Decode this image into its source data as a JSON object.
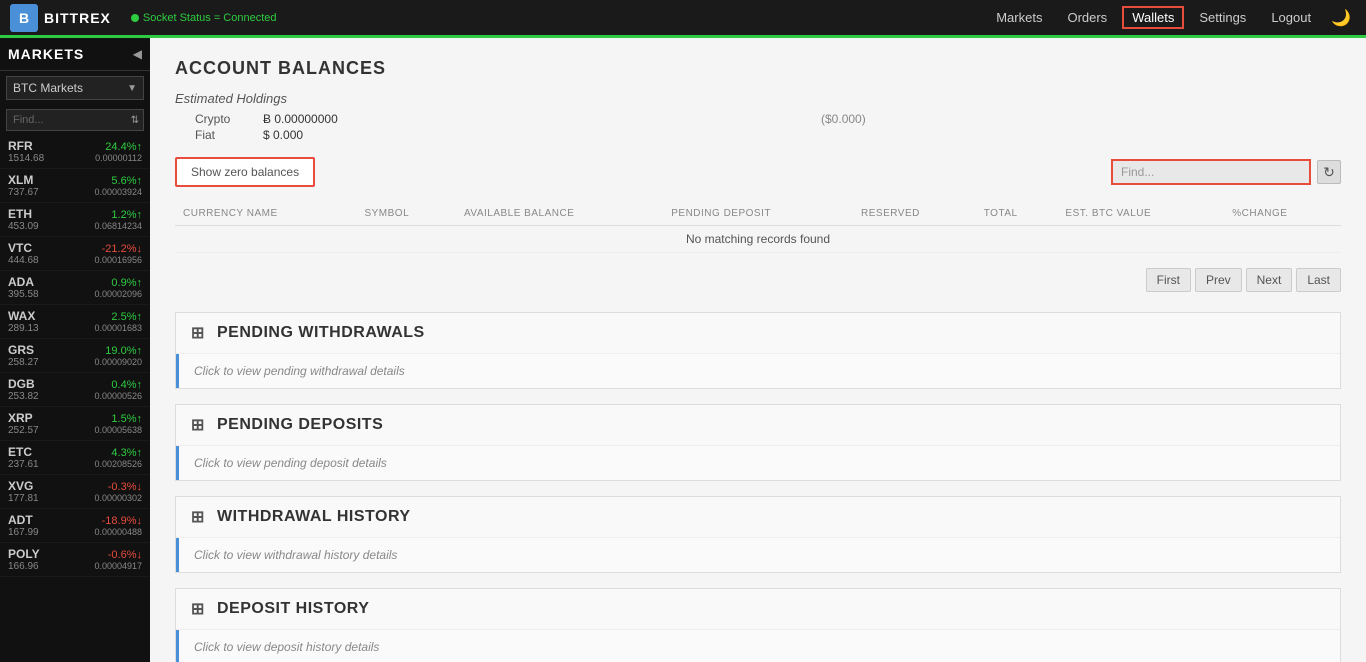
{
  "topnav": {
    "logo_text": "BITTREX",
    "socket_status": "Socket Status = Connected",
    "links": [
      "Markets",
      "Orders",
      "Wallets",
      "Settings",
      "Logout"
    ]
  },
  "sidebar": {
    "title": "MARKETS",
    "collapse_icon": "◀",
    "market_select_label": "BTC Markets",
    "search_placeholder": "Find...",
    "coins": [
      {
        "name": "RFR",
        "price": "1514.68",
        "change": "24.4%↑",
        "btc": "0.00000112",
        "positive": true
      },
      {
        "name": "XLM",
        "price": "737.67",
        "change": "5.6%↑",
        "btc": "0.00003924",
        "positive": true
      },
      {
        "name": "ETH",
        "price": "453.09",
        "change": "1.2%↑",
        "btc": "0.06814234",
        "positive": true
      },
      {
        "name": "VTC",
        "price": "444.68",
        "change": "-21.2%↓",
        "btc": "0.00016956",
        "positive": false
      },
      {
        "name": "ADA",
        "price": "395.58",
        "change": "0.9%↑",
        "btc": "0.00002096",
        "positive": true
      },
      {
        "name": "WAX",
        "price": "289.13",
        "change": "2.5%↑",
        "btc": "0.00001683",
        "positive": true
      },
      {
        "name": "GRS",
        "price": "258.27",
        "change": "19.0%↑",
        "btc": "0.00009020",
        "positive": true
      },
      {
        "name": "DGB",
        "price": "253.82",
        "change": "0.4%↑",
        "btc": "0.00000526",
        "positive": true
      },
      {
        "name": "XRP",
        "price": "252.57",
        "change": "1.5%↑",
        "btc": "0.00005638",
        "positive": true
      },
      {
        "name": "ETC",
        "price": "237.61",
        "change": "4.3%↑",
        "btc": "0.00208526",
        "positive": true
      },
      {
        "name": "XVG",
        "price": "177.81",
        "change": "-0.3%↓",
        "btc": "0.00000302",
        "positive": false
      },
      {
        "name": "ADT",
        "price": "167.99",
        "change": "-18.9%↓",
        "btc": "0.00000488",
        "positive": false
      },
      {
        "name": "POLY",
        "price": "166.96",
        "change": "-0.6%↓",
        "btc": "0.00004917",
        "positive": false
      }
    ]
  },
  "content": {
    "account_balances_title": "ACCOUNT BALANCES",
    "estimated_holdings_label": "Estimated Holdings",
    "holdings": {
      "crypto_label": "Crypto",
      "crypto_value": "Ƀ 0.00000000",
      "crypto_paren": "($0.000)",
      "fiat_label": "Fiat",
      "fiat_value": "$ 0.000"
    },
    "show_zero_btn": "Show zero balances",
    "find_placeholder": "Find...",
    "table": {
      "headers": [
        "CURRENCY NAME",
        "SYMBOL",
        "AVAILABLE BALANCE",
        "PENDING DEPOSIT",
        "RESERVED",
        "TOTAL",
        "EST. BTC VALUE",
        "%CHANGE"
      ],
      "no_records": "No matching records found"
    },
    "pagination": {
      "first": "First",
      "prev": "Prev",
      "next": "Next",
      "last": "Last"
    },
    "pending_withdrawals": {
      "title": "PENDING WITHDRAWALS",
      "body": "Click to view pending withdrawal details"
    },
    "pending_deposits": {
      "title": "PENDING DEPOSITS",
      "body": "Click to view pending deposit details"
    },
    "withdrawal_history": {
      "title": "WITHDRAWAL HISTORY",
      "body": "Click to view withdrawal history details"
    },
    "deposit_history": {
      "title": "DEPOSIT HISTORY",
      "body": "Click to view deposit history details"
    }
  }
}
